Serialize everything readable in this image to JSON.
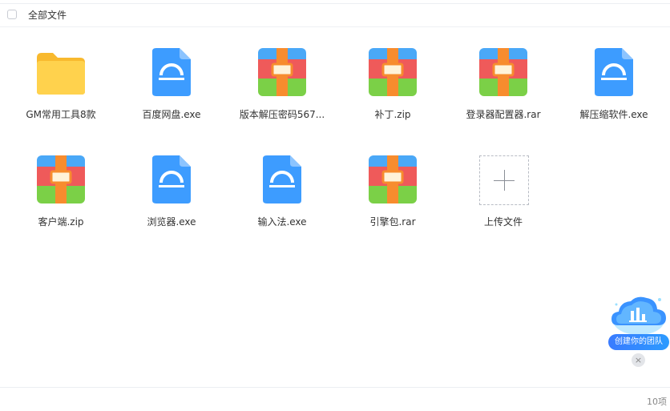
{
  "header": {
    "title": "全部文件"
  },
  "files": [
    {
      "name": "GM常用工具8款",
      "type": "folder-icon"
    },
    {
      "name": "百度网盘.exe",
      "type": "exe-icon"
    },
    {
      "name": "版本解压密码567...",
      "type": "archive-icon"
    },
    {
      "name": "补丁.zip",
      "type": "archive-icon"
    },
    {
      "name": "登录器配置器.rar",
      "type": "archive-icon"
    },
    {
      "name": "解压缩软件.exe",
      "type": "exe-icon"
    },
    {
      "name": "客户端.zip",
      "type": "archive-icon"
    },
    {
      "name": "浏览器.exe",
      "type": "exe-icon"
    },
    {
      "name": "输入法.exe",
      "type": "exe-icon"
    },
    {
      "name": "引擎包.rar",
      "type": "archive-icon"
    }
  ],
  "upload": {
    "label": "上传文件"
  },
  "footer": {
    "count": "10项"
  },
  "promo": {
    "label": "创建你的团队",
    "close": "×"
  },
  "colors": {
    "folder": "#ffc53d",
    "exe": "#3d9cff",
    "archive_top": "#4aa8f7",
    "archive_mid": "#ef5a5a",
    "archive_bottom": "#7bd047",
    "archive_strap": "#f78c2e"
  }
}
